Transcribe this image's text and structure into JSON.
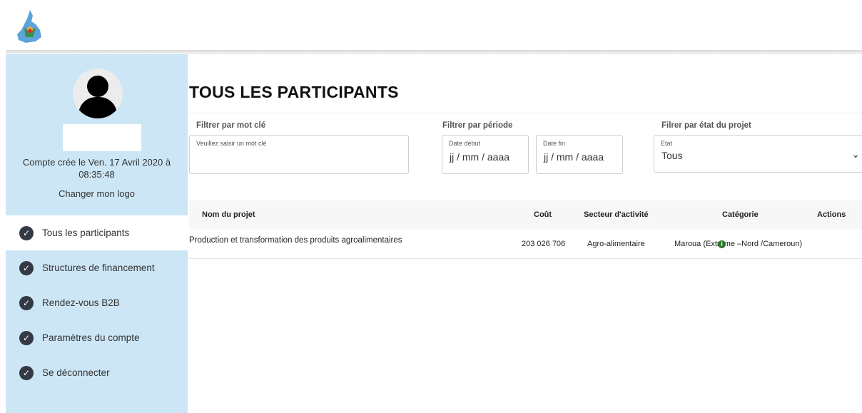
{
  "sidebar": {
    "account_created": "Compte crée le Ven. 17 Avril 2020 à 08:35:48",
    "change_logo": "Changer mon logo",
    "nav": [
      {
        "label": "Tous les participants",
        "active": true
      },
      {
        "label": "Structures de financement",
        "active": false
      },
      {
        "label": "Rendez-vous B2B",
        "active": false
      },
      {
        "label": "Paramètres du compte",
        "active": false
      },
      {
        "label": "Se déconnecter",
        "active": false
      }
    ]
  },
  "main": {
    "title": "TOUS LES PARTICIPANTS",
    "filters": {
      "keyword": {
        "label": "Filtrer par mot clé",
        "placeholder": "Veuillez saisir un mot clé"
      },
      "period": {
        "label": "Filtrer par période",
        "start_label": "Date début",
        "start_value": "jj / mm / aaaa",
        "end_label": "Date fin",
        "end_value": "jj / mm / aaaa"
      },
      "state": {
        "label": "Filrer par état du projet",
        "select_label": "Etat",
        "selected": "Tous"
      }
    },
    "table": {
      "headers": [
        "Nom du projet",
        "Coût",
        "Secteur d'activité",
        "Catégorie",
        "Actions"
      ],
      "rows": [
        {
          "name": "Production et transformation des produits agroalimentaires",
          "cost": "203 026 706",
          "sector": "Agro-alimentaire",
          "category": "Maroua (Extrême –Nord /Cameroun)",
          "action_icon": "info-circle-icon"
        }
      ]
    }
  },
  "colors": {
    "sidebar_bg": "#cce6f5",
    "action_green": "#2c7a2c",
    "check_dark": "#333a45"
  }
}
